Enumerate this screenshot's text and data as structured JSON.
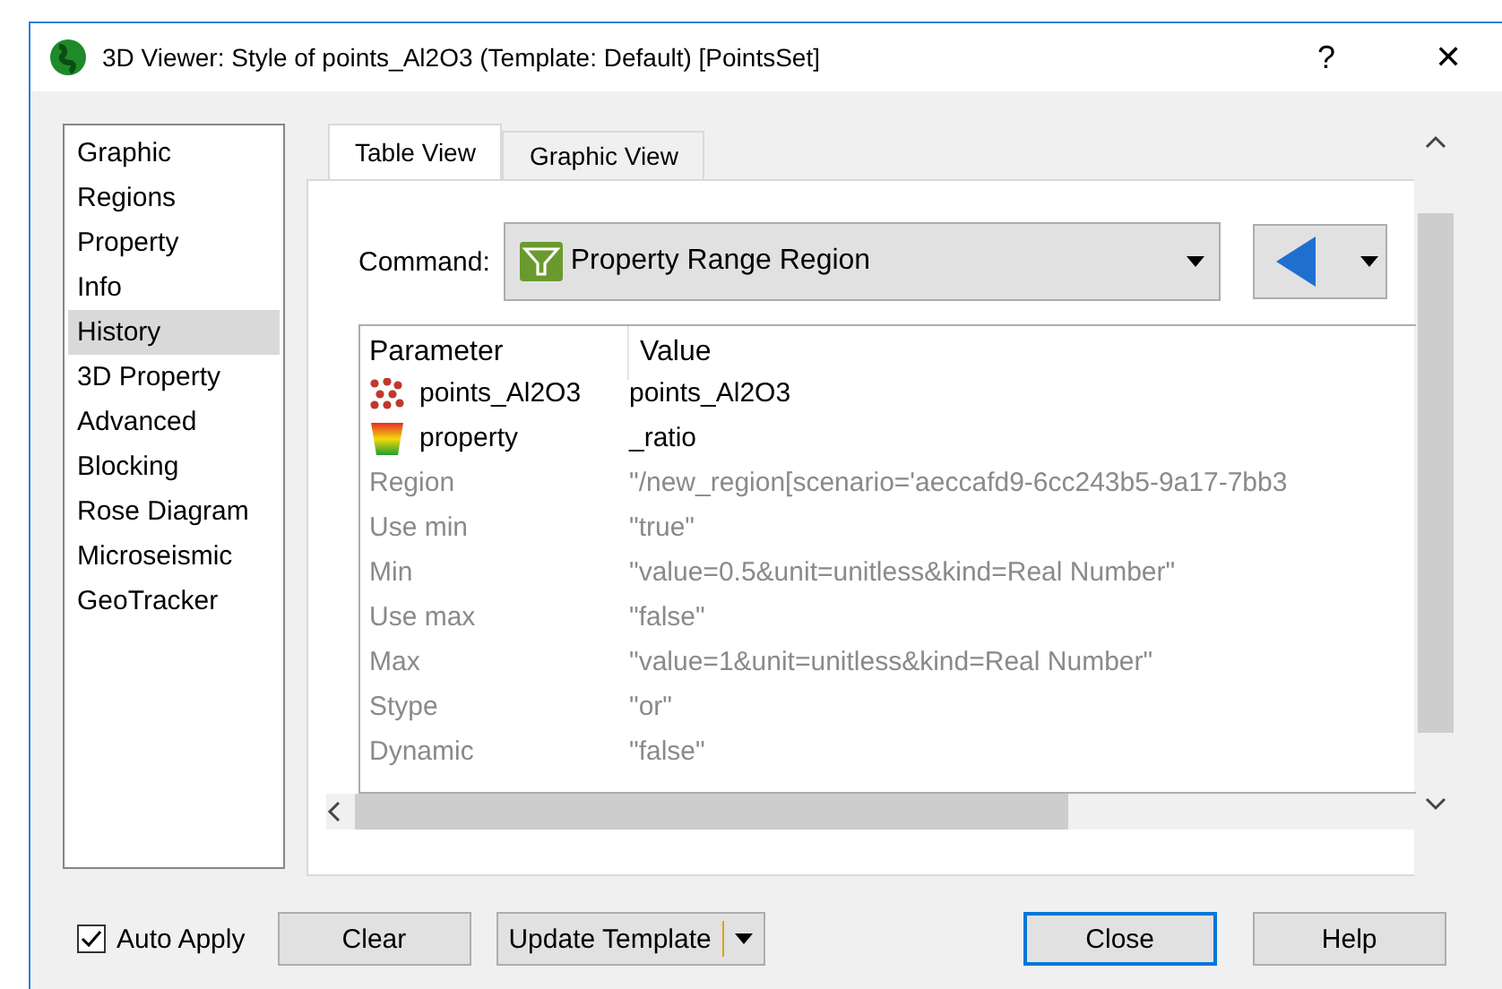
{
  "window": {
    "title": "3D Viewer: Style of points_Al2O3 (Template: Default) [PointsSet]",
    "help": "?",
    "close": "✕"
  },
  "sidebar": {
    "items": [
      {
        "label": "Graphic",
        "selected": false
      },
      {
        "label": "Regions",
        "selected": false
      },
      {
        "label": "Property",
        "selected": false
      },
      {
        "label": "Info",
        "selected": false
      },
      {
        "label": "History",
        "selected": true
      },
      {
        "label": "3D Property",
        "selected": false
      },
      {
        "label": "Advanced",
        "selected": false
      },
      {
        "label": "Blocking",
        "selected": false
      },
      {
        "label": "Rose Diagram",
        "selected": false
      },
      {
        "label": "Microseismic",
        "selected": false
      },
      {
        "label": "GeoTracker",
        "selected": false
      }
    ]
  },
  "tabs": [
    {
      "label": "Table View",
      "selected": true
    },
    {
      "label": "Graphic View",
      "selected": false
    }
  ],
  "command": {
    "label": "Command:",
    "value": "Property Range Region"
  },
  "table": {
    "columns": [
      "Parameter",
      "Value"
    ],
    "rows": [
      {
        "kind": "points",
        "parameter": "points_Al2O3",
        "value": "points_Al2O3",
        "disabled": false
      },
      {
        "kind": "property",
        "parameter": "property",
        "value": "_ratio",
        "disabled": false
      },
      {
        "kind": "plain",
        "parameter": "Region",
        "value": "\"/new_region[scenario='aeccafd9-6cc243b5-9a17-7bb3",
        "disabled": true
      },
      {
        "kind": "plain",
        "parameter": "Use min",
        "value": "\"true\"",
        "disabled": true
      },
      {
        "kind": "plain",
        "parameter": "Min",
        "value": "\"value=0.5&unit=unitless&kind=Real Number\"",
        "disabled": true
      },
      {
        "kind": "plain",
        "parameter": "Use max",
        "value": "\"false\"",
        "disabled": true
      },
      {
        "kind": "plain",
        "parameter": "Max",
        "value": "\"value=1&unit=unitless&kind=Real Number\"",
        "disabled": true
      },
      {
        "kind": "plain",
        "parameter": "Stype",
        "value": "\"or\"",
        "disabled": true
      },
      {
        "kind": "plain",
        "parameter": "Dynamic",
        "value": "\"false\"",
        "disabled": true
      }
    ]
  },
  "footer": {
    "auto_apply": {
      "label": "Auto Apply",
      "checked": true
    },
    "buttons": [
      {
        "label": "Clear",
        "kind": "plain",
        "selected": false
      },
      {
        "label": "Update Template",
        "kind": "split",
        "selected": false
      },
      {
        "label": "Close",
        "kind": "plain",
        "selected": true
      },
      {
        "label": "Help",
        "kind": "plain",
        "selected": false
      }
    ]
  }
}
